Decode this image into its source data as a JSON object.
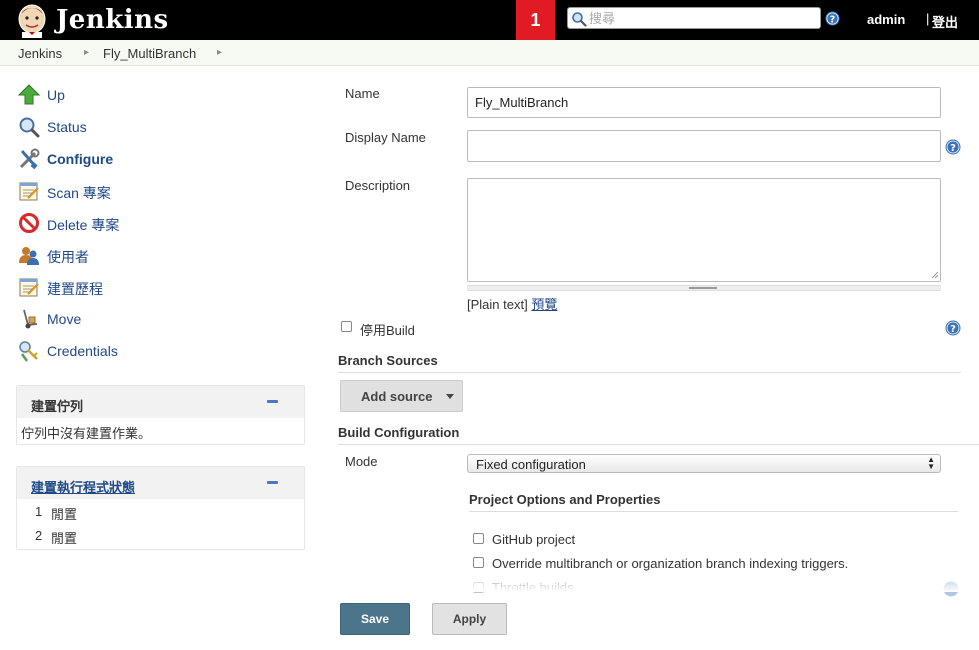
{
  "header": {
    "brand": "Jenkins",
    "notification_count": "1",
    "search_placeholder": "搜尋",
    "user": "admin",
    "separator": "|",
    "logout": "登出"
  },
  "breadcrumb": [
    "Jenkins",
    "Fly_MultiBranch"
  ],
  "sidebar": {
    "tasks": [
      {
        "label": "Up",
        "icon": "up-arrow-icon"
      },
      {
        "label": "Status",
        "icon": "magnifier-icon"
      },
      {
        "label": "Configure",
        "icon": "wrench-screwdriver-icon",
        "active": true
      },
      {
        "label": "Scan 專案",
        "icon": "notepad-icon"
      },
      {
        "label": "Delete 專案",
        "icon": "no-entry-icon"
      },
      {
        "label": "使用者",
        "icon": "users-icon"
      },
      {
        "label": "建置歷程",
        "icon": "notepad-icon"
      },
      {
        "label": "Move",
        "icon": "hand-truck-icon"
      },
      {
        "label": "Credentials",
        "icon": "keys-icon"
      }
    ],
    "build_queue": {
      "title": "建置佇列",
      "empty_text": "佇列中沒有建置作業。"
    },
    "executors": {
      "title": "建置執行程式狀態",
      "rows": [
        {
          "number": "1",
          "status": "閒置"
        },
        {
          "number": "2",
          "status": "閒置"
        }
      ]
    }
  },
  "form": {
    "name_label": "Name",
    "name_value": "Fly_MultiBranch",
    "display_name_label": "Display Name",
    "display_name_value": "",
    "description_label": "Description",
    "description_value": "",
    "markup_format": "[Plain text]",
    "preview_link": "預覽",
    "disable_build_label": "停用Build",
    "branch_sources_title": "Branch Sources",
    "add_source_label": "Add source",
    "build_configuration_title": "Build Configuration",
    "mode_label": "Mode",
    "mode_value": "Fixed configuration",
    "project_options_title": "Project Options and Properties",
    "options": [
      {
        "label": "GitHub project",
        "checked": false
      },
      {
        "label": "Override multibranch or organization branch indexing triggers.",
        "checked": false
      },
      {
        "label": "Throttle builds",
        "checked": false
      }
    ],
    "save_label": "Save",
    "apply_label": "Apply"
  },
  "colors": {
    "header_bg": "#000000",
    "notification_bg": "#e01b24",
    "link": "#204a87",
    "save_button": "#4b758b"
  }
}
